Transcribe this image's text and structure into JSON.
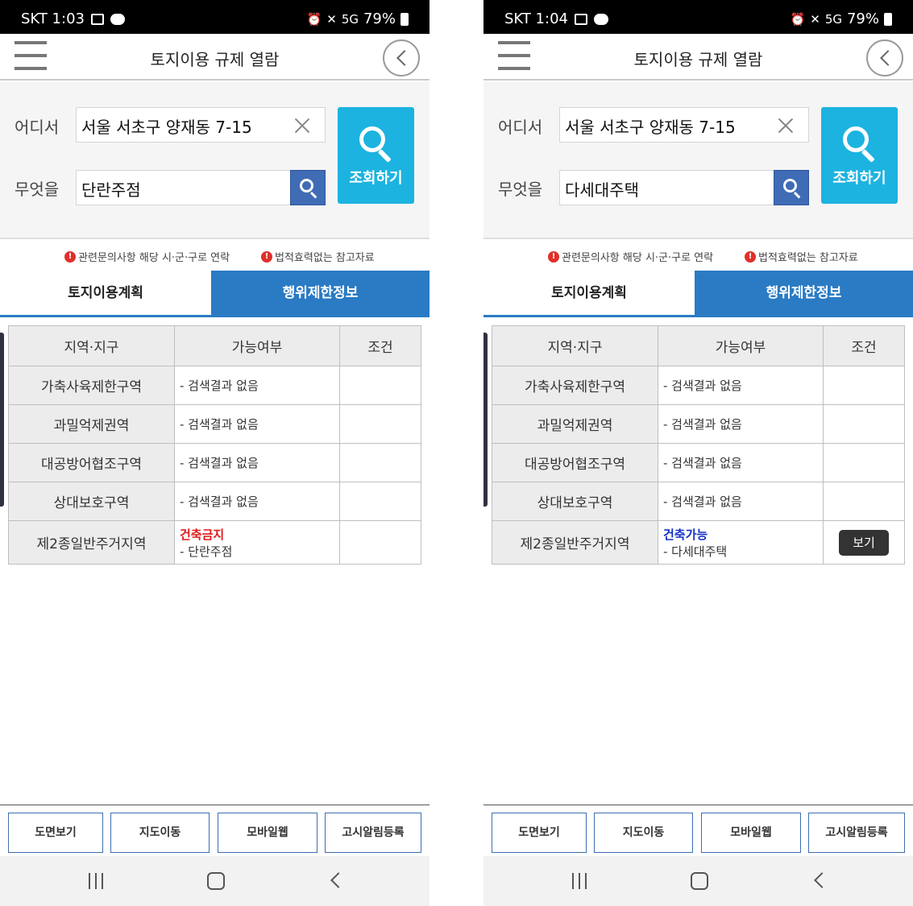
{
  "screens": [
    {
      "status": {
        "time": "SKT 1:03",
        "signal": "5G",
        "battery": "79%"
      },
      "header": {
        "title": "토지이용 규제 열람"
      },
      "search": {
        "where_label": "어디서",
        "where_value": "서울 서초구 양재동 7-15",
        "what_label": "무엇을",
        "what_value": "단란주점",
        "query_button": "조회하기"
      },
      "notices": [
        "관련문의사항 해당 시·군·구로 연락",
        "법적효력없는 참고자료"
      ],
      "tabs": [
        "토지이용계획",
        "행위제한정보"
      ],
      "table": {
        "headers": [
          "지역·지구",
          "가능여부",
          "조건"
        ],
        "rows": [
          {
            "zone": "가축사육제한구역",
            "result": "- 검색결과 없음"
          },
          {
            "zone": "과밀억제권역",
            "result": "- 검색결과 없음"
          },
          {
            "zone": "대공방어협조구역",
            "result": "- 검색결과 없음"
          },
          {
            "zone": "상대보호구역",
            "result": "- 검색결과 없음"
          }
        ],
        "last_row": {
          "zone": "제2종일반주거지역",
          "status": "건축금지",
          "use": "- 단란주점",
          "condition": ""
        }
      },
      "bottom_buttons": [
        "도면보기",
        "지도이동",
        "모바일웹",
        "고시알림등록"
      ]
    },
    {
      "status": {
        "time": "SKT 1:04",
        "signal": "5G",
        "battery": "79%"
      },
      "header": {
        "title": "토지이용 규제 열람"
      },
      "search": {
        "where_label": "어디서",
        "where_value": "서울 서초구 양재동 7-15",
        "what_label": "무엇을",
        "what_value": "다세대주택",
        "query_button": "조회하기"
      },
      "notices": [
        "관련문의사항 해당 시·군·구로 연락",
        "법적효력없는 참고자료"
      ],
      "tabs": [
        "토지이용계획",
        "행위제한정보"
      ],
      "table": {
        "headers": [
          "지역·지구",
          "가능여부",
          "조건"
        ],
        "rows": [
          {
            "zone": "가축사육제한구역",
            "result": "- 검색결과 없음"
          },
          {
            "zone": "과밀억제권역",
            "result": "- 검색결과 없음"
          },
          {
            "zone": "대공방어협조구역",
            "result": "- 검색결과 없음"
          },
          {
            "zone": "상대보호구역",
            "result": "- 검색결과 없음"
          }
        ],
        "last_row": {
          "zone": "제2종일반주거지역",
          "status": "건축가능",
          "use": "- 다세대주택",
          "condition": "보기"
        }
      },
      "bottom_buttons": [
        "도면보기",
        "지도이동",
        "모바일웹",
        "고시알림등록"
      ]
    }
  ],
  "colors": {
    "status_deny": "#e11a1a",
    "status_allow": "#1530c8",
    "accent_blue": "#2a7bc4",
    "query_button": "#1cb3e0",
    "search_mini_button": "#3f6cb4"
  },
  "icons": [
    "menu-icon",
    "back-icon",
    "clear-icon",
    "search-icon",
    "warning-icon",
    "nav-recent-icon",
    "nav-home-icon",
    "nav-back-icon"
  ]
}
